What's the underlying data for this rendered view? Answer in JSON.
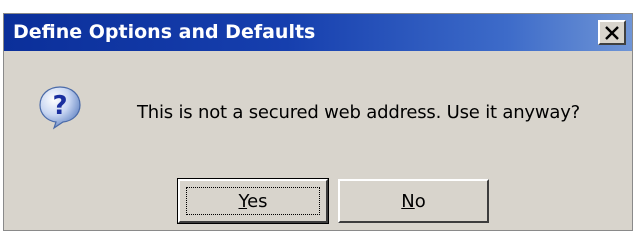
{
  "dialog": {
    "title": "Define Options and Defaults",
    "message": "This is not a secured web address.  Use it anyway?",
    "icon": "question-icon",
    "buttons": {
      "yes": {
        "mnemonic": "Y",
        "rest": "es"
      },
      "no": {
        "mnemonic": "N",
        "rest": "o"
      }
    }
  },
  "colors": {
    "titlebar_start": "#0b2f9a",
    "titlebar_end": "#6f95d6",
    "face": "#d8d4cc"
  }
}
